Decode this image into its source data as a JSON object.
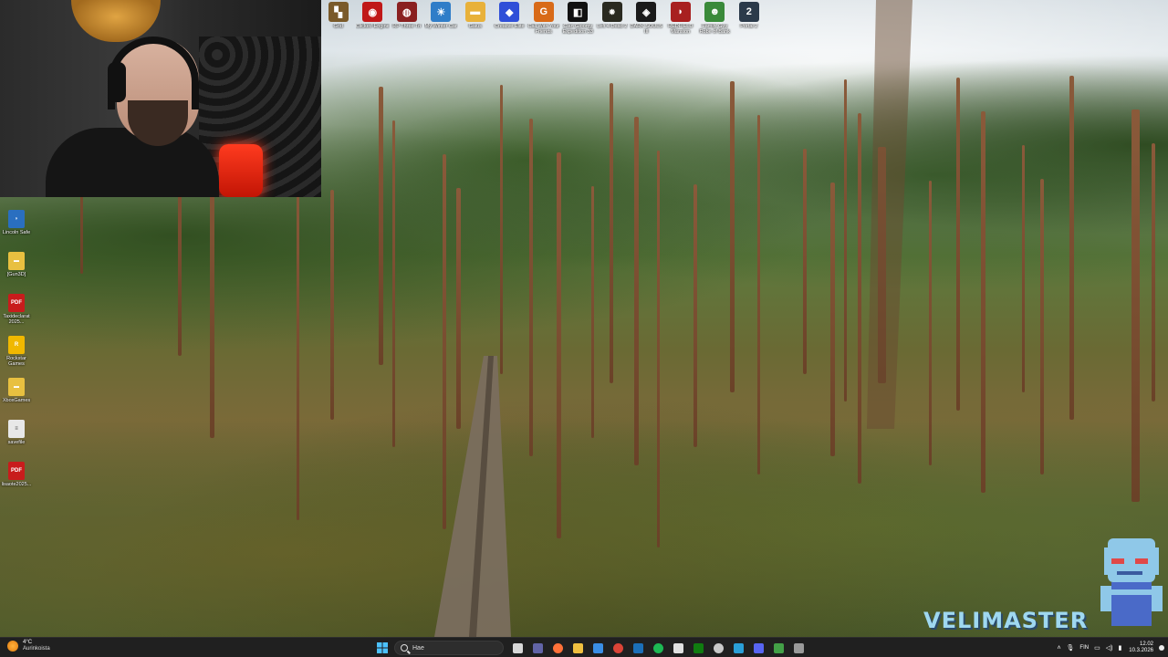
{
  "desktop": {
    "top_icons": [
      {
        "label": "Grid",
        "color": "#7a5a2a",
        "glyph": "▚"
      },
      {
        "label": "Clicker/ Engine",
        "color": "#c01818",
        "glyph": "◉"
      },
      {
        "label": "RP Three Tri",
        "color": "#8a2020",
        "glyph": "◍"
      },
      {
        "label": "My Winter Car",
        "color": "#2f7dc8",
        "glyph": "☀"
      },
      {
        "label": "Gaius",
        "color": "#e8b13a",
        "glyph": "▬"
      },
      {
        "label": "Creative Elite",
        "color": "#2f4fd8",
        "glyph": "◆"
      },
      {
        "label": "Call With Your Friends",
        "color": "#d86a18",
        "glyph": "G"
      },
      {
        "label": "Clan Gloomy Expedition 33",
        "color": "#111111",
        "glyph": "◧"
      },
      {
        "label": "Left 4 Dead 2",
        "color": "#2a2a20",
        "glyph": "⁕"
      },
      {
        "label": "DARK SOULS III",
        "color": "#1a1a1a",
        "glyph": "◈"
      },
      {
        "label": "REDFIELD Mansion",
        "color": "#a82020",
        "glyph": "◗"
      },
      {
        "label": "Family Guy Robe of Bank",
        "color": "#3a8a3a",
        "glyph": "☻"
      },
      {
        "label": "Portal 2",
        "color": "#2b3a4a",
        "glyph": "2"
      }
    ],
    "left_icons": [
      {
        "label": "Lincoln Safe",
        "color": "#2a6fc0",
        "glyph": "◗"
      },
      {
        "label": "[Gun3D]",
        "color": "#e8c040",
        "glyph": "▬"
      },
      {
        "label": "Taxideclarat 2025...",
        "color": "#c81c1c",
        "glyph": "PDF"
      },
      {
        "label": "Rockstar Games",
        "color": "#f0b800",
        "glyph": "R"
      },
      {
        "label": "XboxGames",
        "color": "#e8c040",
        "glyph": "▬"
      },
      {
        "label": "savefile",
        "color": "#e8e8e8",
        "glyph": "≡"
      },
      {
        "label": "lisaote2025...",
        "color": "#c81c1c",
        "glyph": "PDF"
      }
    ]
  },
  "watermark": {
    "text": "VELIMASTER"
  },
  "taskbar": {
    "weather": {
      "temp": "4°C",
      "desc": "Aurinkoista"
    },
    "search": {
      "placeholder": "Hae"
    },
    "apps": [
      {
        "name": "task-view",
        "color": "#d8d8d8"
      },
      {
        "name": "teams",
        "color": "#6264a7"
      },
      {
        "name": "firefox",
        "color": "#ff7139"
      },
      {
        "name": "file-explorer",
        "color": "#f0c040"
      },
      {
        "name": "store",
        "color": "#3a8ee6"
      },
      {
        "name": "chrome-active",
        "color": "#db4437"
      },
      {
        "name": "steam",
        "color": "#1b6fb8"
      },
      {
        "name": "spotify",
        "color": "#1db954"
      },
      {
        "name": "epic",
        "color": "#e0e0e0"
      },
      {
        "name": "xbox",
        "color": "#107c10"
      },
      {
        "name": "obs",
        "color": "#c8c8c8"
      },
      {
        "name": "snipping",
        "color": "#2a9fd8"
      },
      {
        "name": "discord",
        "color": "#5865f2"
      },
      {
        "name": "game-bar",
        "color": "#43a047"
      },
      {
        "name": "calculator",
        "color": "#9a9a9a"
      }
    ],
    "tray": {
      "lang": "FIN",
      "time": "12.02",
      "date": "10.3.2026"
    }
  }
}
